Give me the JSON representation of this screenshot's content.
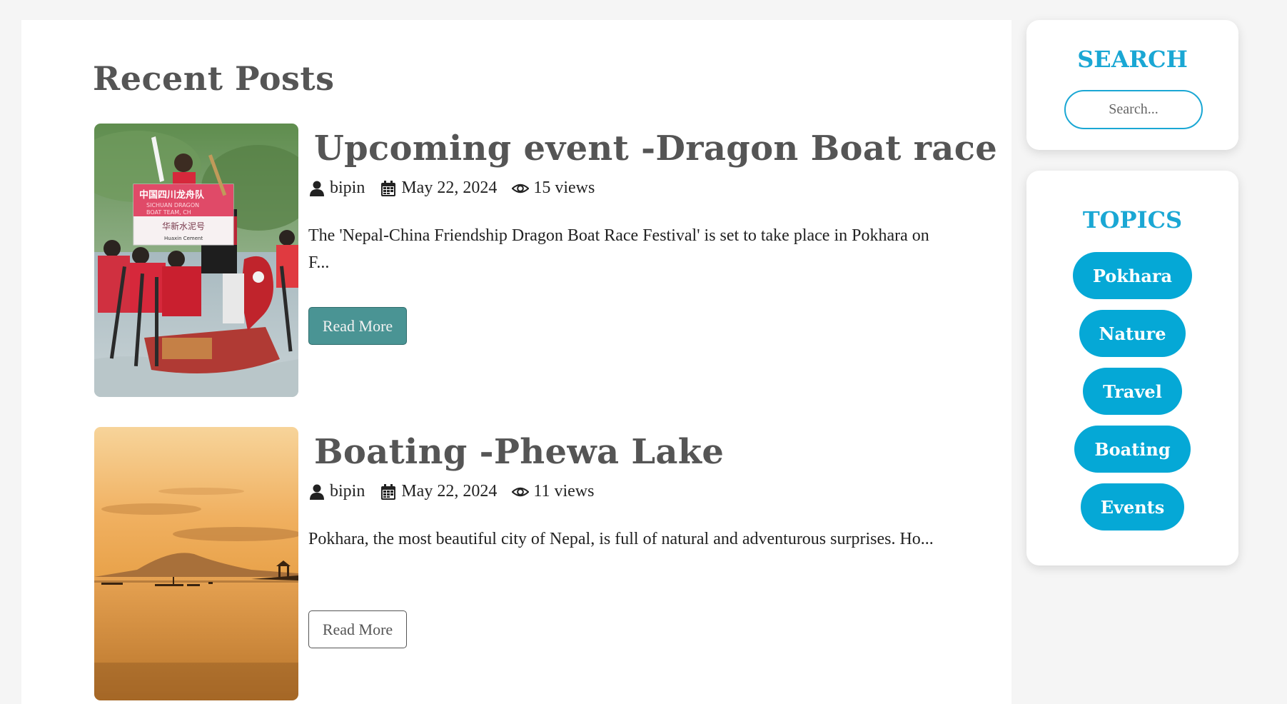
{
  "main": {
    "section_title": "Recent Posts",
    "posts": [
      {
        "title": "Upcoming event -Dragon Boat race",
        "author": "bipin",
        "date": "May 22, 2024",
        "views": "15 views",
        "excerpt": "The 'Nepal-China Friendship Dragon Boat Race Festival' is set to take place in Pokhara on F...",
        "read_more": "Read More",
        "image_sign_line1": "中国四川龙舟队",
        "image_sign_line2": "SICHUAN DRAGON",
        "image_sign_line3": "BOAT TEAM, CH",
        "image_sign_line4": "华新水泥号",
        "image_sign_line5": "Huaxin Cement"
      },
      {
        "title": "Boating -Phewa Lake",
        "author": "bipin",
        "date": "May 22, 2024",
        "views": "11 views",
        "excerpt": "Pokhara, the most beautiful city of Nepal, is full of natural and adventurous surprises. Ho...",
        "read_more": "Read More"
      }
    ]
  },
  "sidebar": {
    "search": {
      "title": "SEARCH",
      "placeholder": "Search..."
    },
    "topics": {
      "title": "TOPICS",
      "items": [
        "Pokhara",
        "Nature",
        "Travel",
        "Boating",
        "Events"
      ]
    }
  },
  "icons": {
    "author": "user-icon",
    "date": "calendar-icon",
    "views": "eye-icon"
  },
  "colors": {
    "accent": "#1aa7d4",
    "topic_pill": "#05a8d6",
    "read_more_active": "#4a9494",
    "heading": "#555555"
  }
}
